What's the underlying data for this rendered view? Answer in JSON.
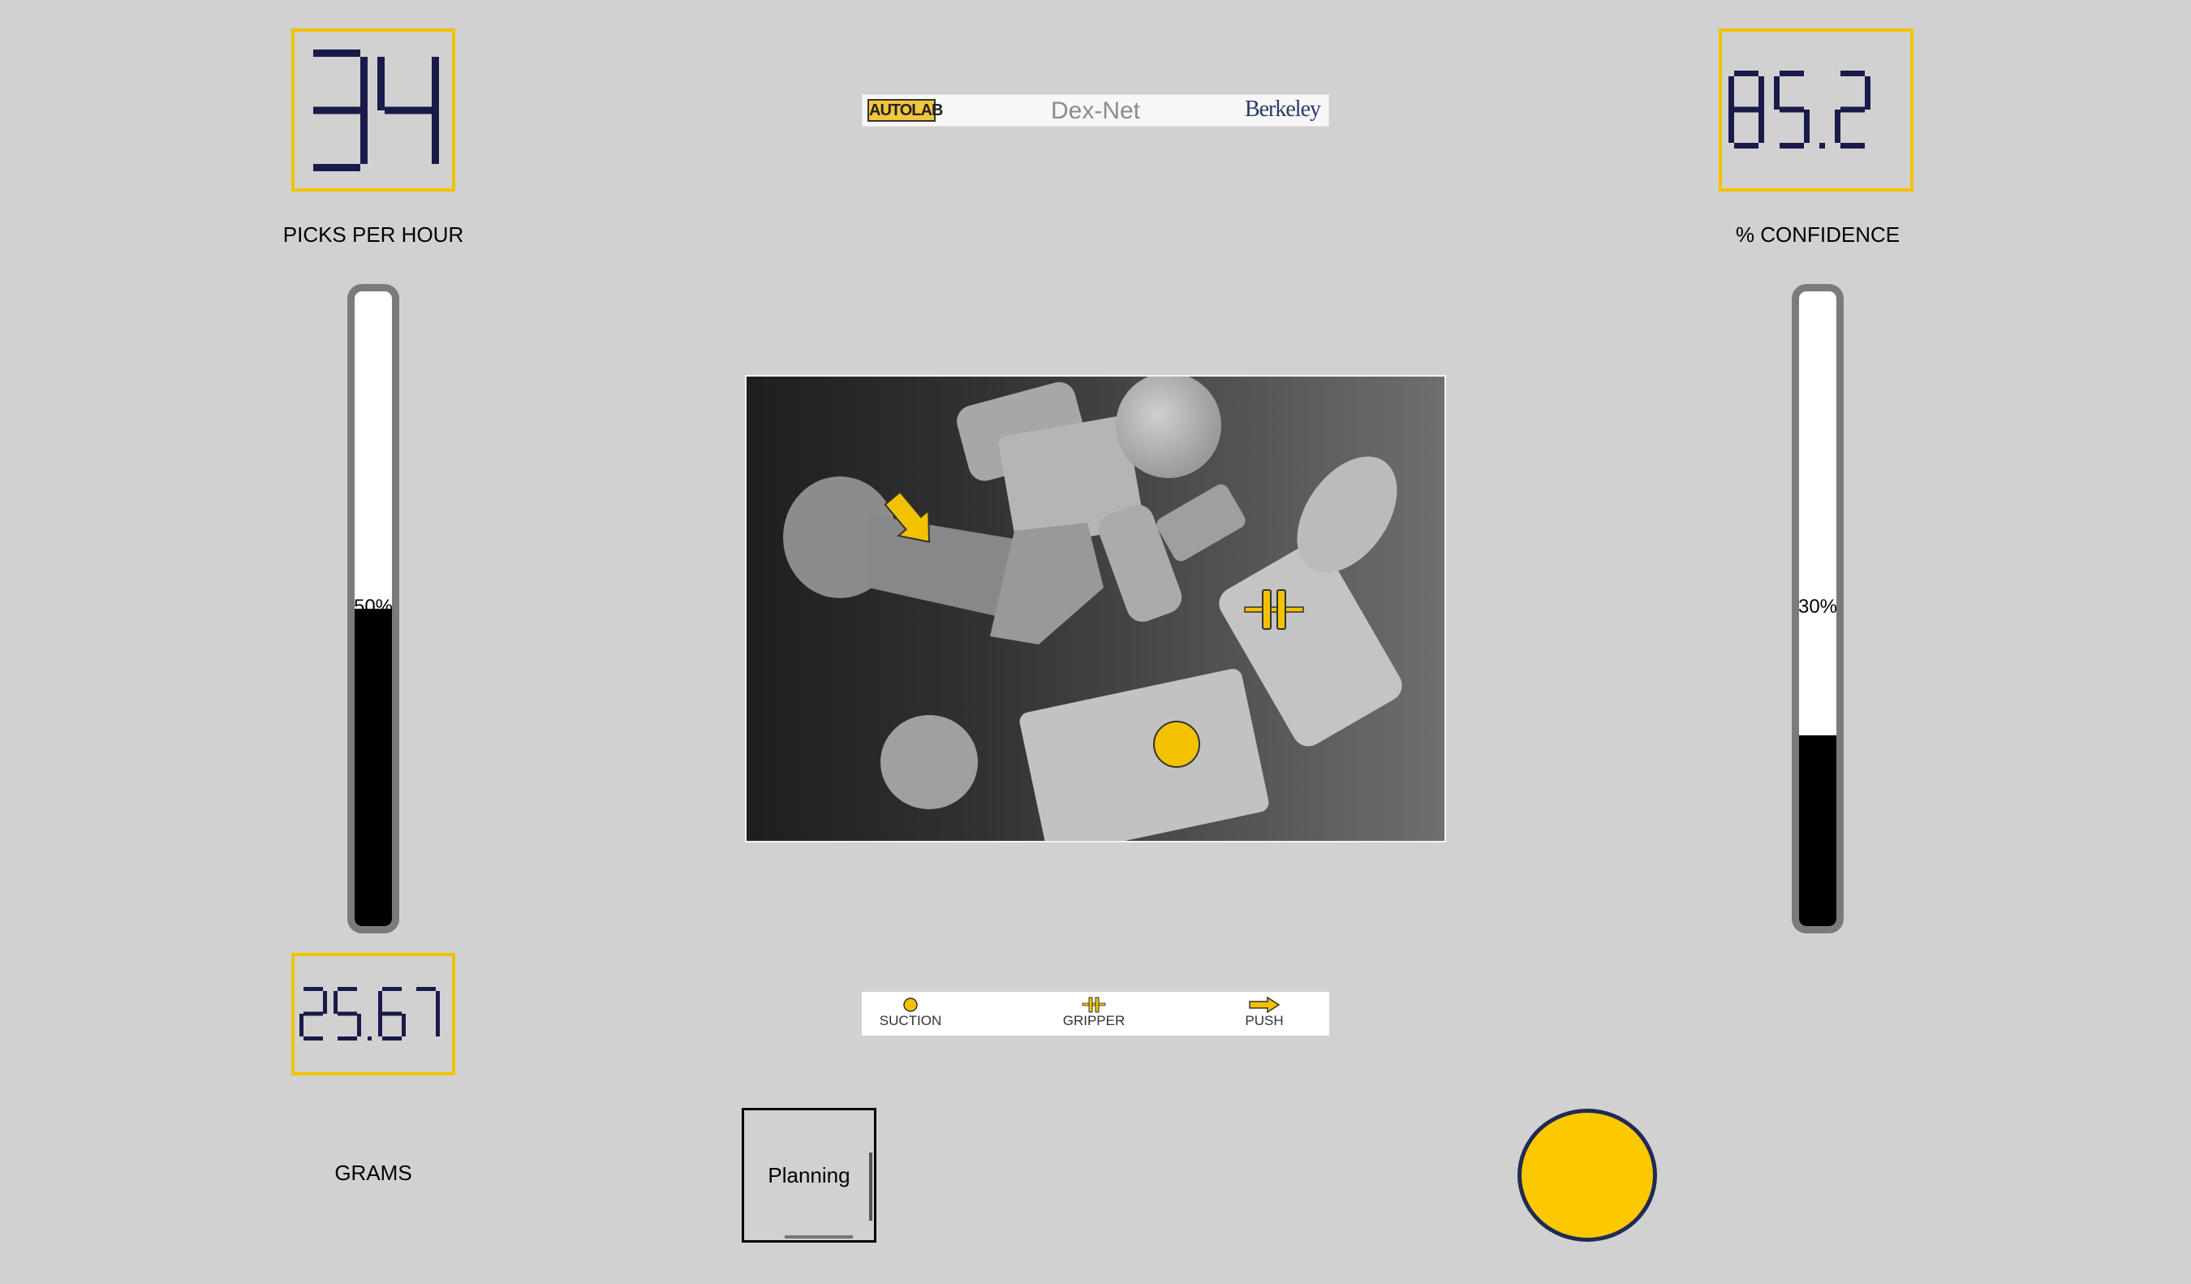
{
  "stats": {
    "picks_per_hour": {
      "value": "34",
      "label": "PICKS PER HOUR"
    },
    "confidence": {
      "value": "85.2",
      "label": "% CONFIDENCE"
    },
    "grams": {
      "value": "25.67",
      "label": "GRAMS"
    }
  },
  "gauges": {
    "left": {
      "percent": 50,
      "text": "50%"
    },
    "right": {
      "percent": 30,
      "text": "30%"
    }
  },
  "banner": {
    "left": "AUTOLAB",
    "center": "Dex-Net",
    "right": "Berkeley"
  },
  "legend": {
    "suction": "SUCTION",
    "gripper": "GRIPPER",
    "push": "PUSH"
  },
  "planning_button": {
    "label": "Planning"
  },
  "colors": {
    "accent": "#f2c200",
    "digit": "#1a1a4a",
    "background": "#d1d1d1",
    "button": "#fcc800"
  }
}
